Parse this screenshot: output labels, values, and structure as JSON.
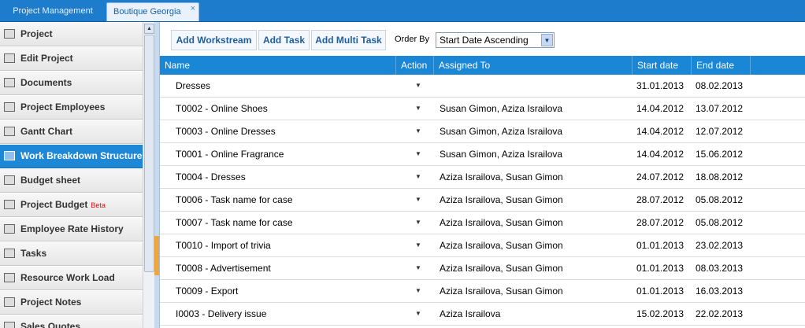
{
  "tabs": [
    {
      "label": "Project Management"
    },
    {
      "label": "Boutique Georgia",
      "close": "×"
    }
  ],
  "sidebar": {
    "items": [
      {
        "label": "Project",
        "icon": "project-icon"
      },
      {
        "label": "Edit Project",
        "icon": "edit-icon"
      },
      {
        "label": "Documents",
        "icon": "documents-icon"
      },
      {
        "label": "Project Employees",
        "icon": "employees-icon"
      },
      {
        "label": "Gantt Chart",
        "icon": "gantt-icon"
      },
      {
        "label": "Work Breakdown Structure",
        "icon": "wbs-icon",
        "active": true
      },
      {
        "label": "Budget sheet",
        "icon": "budget-sheet-icon"
      },
      {
        "label": "Project Budget",
        "icon": "project-budget-icon",
        "badge": "Beta"
      },
      {
        "label": "Employee Rate History",
        "icon": "rate-history-icon"
      },
      {
        "label": "Tasks",
        "icon": "tasks-icon"
      },
      {
        "label": "Resource Work Load",
        "icon": "resource-icon"
      },
      {
        "label": "Project Notes",
        "icon": "notes-icon"
      },
      {
        "label": "Sales Quotes",
        "icon": "quotes-icon"
      }
    ]
  },
  "toolbar": {
    "add_workstream": "Add Workstream",
    "add_task": "Add Task",
    "add_multi_task": "Add Multi Task",
    "order_by_label": "Order By",
    "order_by_value": "Start Date Ascending"
  },
  "table": {
    "columns": [
      "Name",
      "Action",
      "Assigned To",
      "Start date",
      "End date"
    ],
    "rows": [
      {
        "name": "Dresses",
        "assigned": "",
        "start": "31.01.2013",
        "end": "08.02.2013"
      },
      {
        "name": "T0002 - Online Shoes",
        "assigned": "Susan Gimon, Aziza Israilova",
        "start": "14.04.2012",
        "end": "13.07.2012"
      },
      {
        "name": "T0003 - Online Dresses",
        "assigned": "Susan Gimon, Aziza Israilova",
        "start": "14.04.2012",
        "end": "12.07.2012"
      },
      {
        "name": "T0001 - Online Fragrance",
        "assigned": "Susan Gimon, Aziza Israilova",
        "start": "14.04.2012",
        "end": "15.06.2012"
      },
      {
        "name": "T0004 - Dresses",
        "assigned": "Aziza Israilova, Susan Gimon",
        "start": "24.07.2012",
        "end": "18.08.2012"
      },
      {
        "name": "T0006 - Task name for case",
        "assigned": "Aziza Israilova, Susan Gimon",
        "start": "28.07.2012",
        "end": "05.08.2012"
      },
      {
        "name": "T0007 - Task name for case",
        "assigned": "Aziza Israilova, Susan Gimon",
        "start": "28.07.2012",
        "end": "05.08.2012"
      },
      {
        "name": "T0010 - Import of trivia",
        "assigned": "Aziza Israilova, Susan Gimon",
        "start": "01.01.2013",
        "end": "23.02.2013"
      },
      {
        "name": "T0008 - Advertisement",
        "assigned": "Aziza Israilova, Susan Gimon",
        "start": "01.01.2013",
        "end": "08.03.2013"
      },
      {
        "name": "T0009 - Export",
        "assigned": "Aziza Israilova, Susan Gimon",
        "start": "01.01.2013",
        "end": "16.03.2013"
      },
      {
        "name": "I0003 - Delivery issue",
        "assigned": "Aziza Israilova",
        "start": "15.02.2013",
        "end": "22.02.2013"
      }
    ]
  },
  "colors": {
    "accent": "#1a86d6",
    "topbar": "#1d7ccc",
    "splitter_grip": "#f0a63c"
  }
}
